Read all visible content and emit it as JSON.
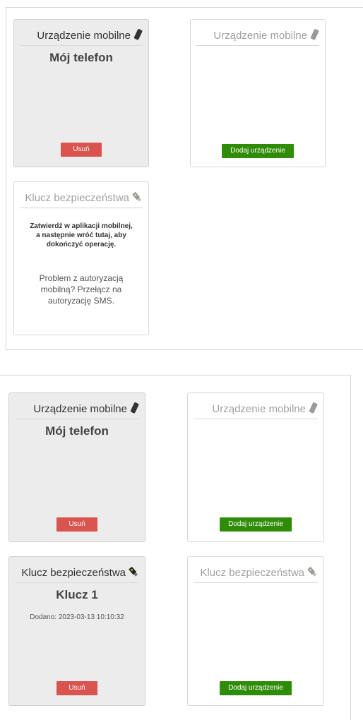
{
  "section1": {
    "mobile_active": {
      "title": "Urządzenie mobilne",
      "icon": "phone-icon",
      "device_name": "Mój telefon",
      "button": "Usuń"
    },
    "mobile_empty": {
      "title": "Urządzenie mobilne",
      "icon": "phone-icon",
      "button": "Dodaj urządzenie"
    },
    "key_pending": {
      "title": "Klucz bezpieczeństwa",
      "icon": "usb-key-icon",
      "confirm_text": "Zatwierdź w aplikacji mobilnej,\na następnie wróć tutaj, aby dokończyć operację.",
      "help_text": "Problem z autoryzacją mobilną? Przełącz na autoryzację SMS."
    }
  },
  "section2": {
    "mobile_active": {
      "title": "Urządzenie mobilne",
      "icon": "phone-icon",
      "device_name": "Mój telefon",
      "button": "Usuń"
    },
    "mobile_empty": {
      "title": "Urządzenie mobilne",
      "icon": "phone-icon",
      "button": "Dodaj urządzenie"
    },
    "key_active": {
      "title": "Klucz bezpieczeństwa",
      "icon": "usb-key-icon",
      "device_name": "Klucz 1",
      "added_label": "Dodano:",
      "added_date": "2023-03-13 10:10:32",
      "button": "Usuń"
    },
    "key_empty": {
      "title": "Klucz bezpieczeństwa",
      "icon": "usb-key-icon",
      "button": "Dodaj urządzenie"
    }
  },
  "colors": {
    "danger": "#d9534f",
    "success": "#2f8c08",
    "card_active_bg": "#ececec",
    "title_muted": "#a0a0a0"
  }
}
